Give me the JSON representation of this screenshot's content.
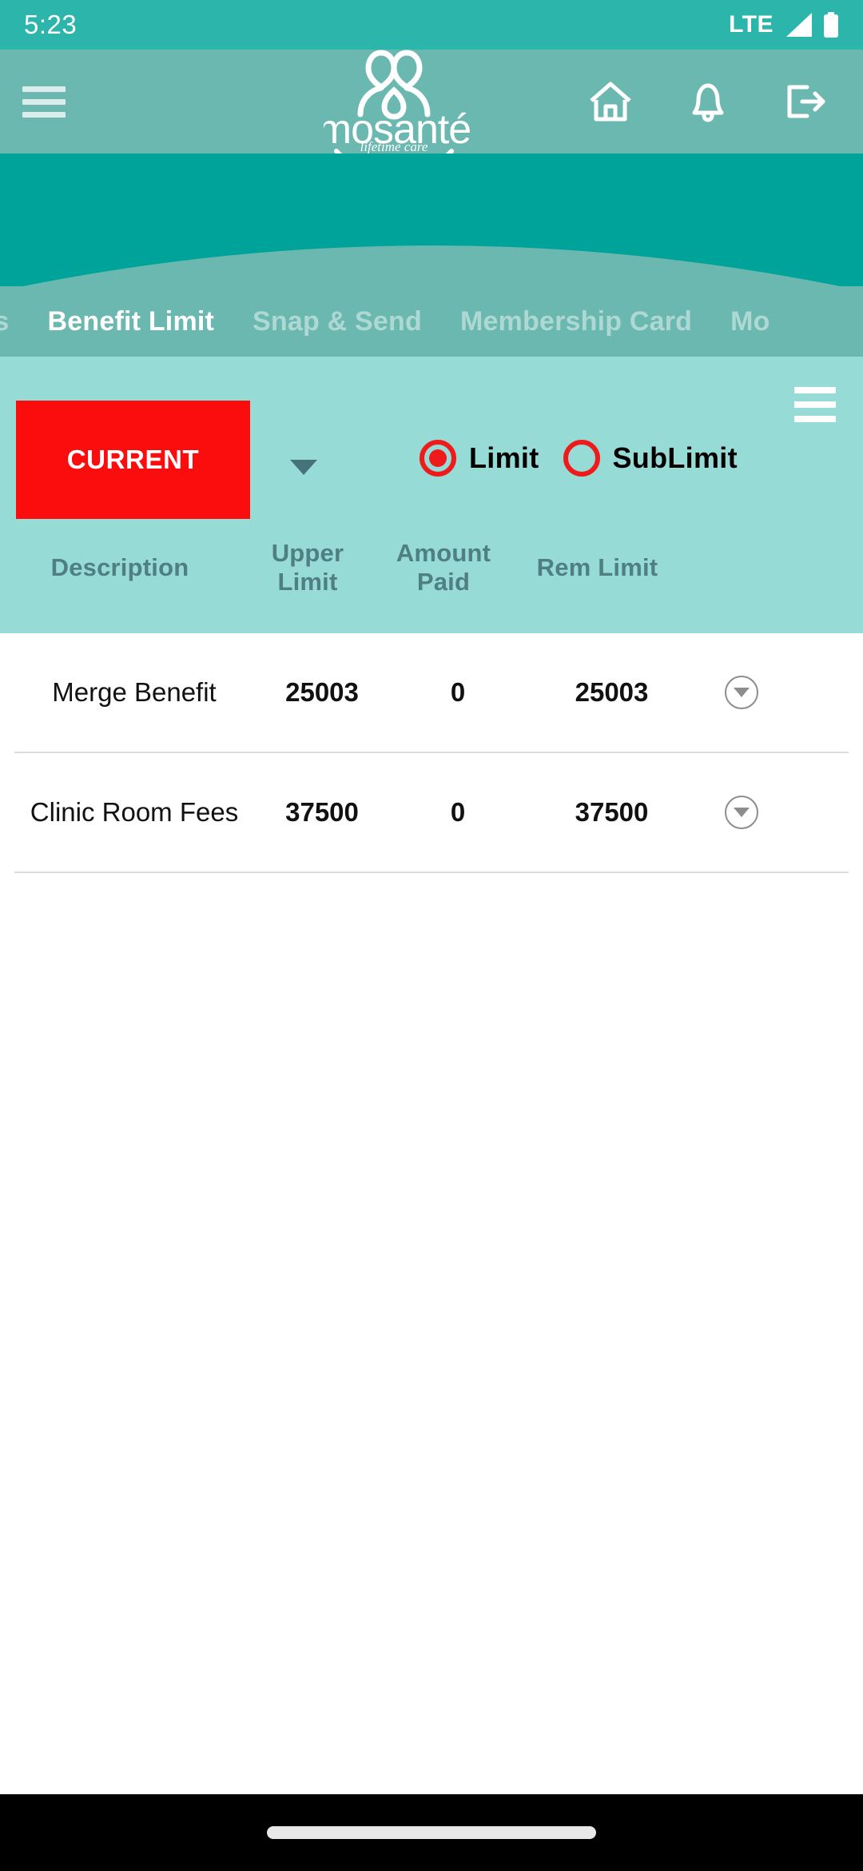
{
  "status_bar": {
    "time": "5:23",
    "network": "LTE",
    "signal_icon": "signal-triangle-icon",
    "battery_icon": "battery-full-icon"
  },
  "header": {
    "menu_icon": "hamburger-menu-icon",
    "brand_name": "mosanté",
    "brand_tagline": "lifetime care",
    "logo_icon": "two-people-logo-icon",
    "icons": [
      {
        "name": "home-icon",
        "label": "Home"
      },
      {
        "name": "bell-icon",
        "label": "Notifications"
      },
      {
        "name": "logout-icon",
        "label": "Logout"
      }
    ]
  },
  "tabs": [
    {
      "label": "ms",
      "active": false,
      "clipped": true
    },
    {
      "label": "Benefit Limit",
      "active": true,
      "clipped": false
    },
    {
      "label": "Snap & Send",
      "active": false,
      "clipped": false
    },
    {
      "label": "Membership Card",
      "active": false,
      "clipped": false
    },
    {
      "label": "Mo",
      "active": false,
      "clipped": true
    }
  ],
  "panel": {
    "menu_icon": "panel-hamburger-icon",
    "period_button": "CURRENT",
    "dropdown_icon": "chevron-down-icon",
    "radios": [
      {
        "label": "Limit",
        "selected": true
      },
      {
        "label": "SubLimit",
        "selected": false
      }
    ]
  },
  "table": {
    "columns": [
      "Description",
      "Upper Limit",
      "Amount Paid",
      "Rem Limit"
    ],
    "rows": [
      {
        "description": "Merge Benefit",
        "upper_limit": "25003",
        "amount_paid": "0",
        "rem_limit": "25003",
        "expand_icon": "row-expand-icon"
      },
      {
        "description": "Clinic Room Fees",
        "upper_limit": "37500",
        "amount_paid": "0",
        "rem_limit": "37500",
        "expand_icon": "row-expand-icon"
      }
    ]
  },
  "nav_bar": {
    "home_pill": "home-gesture-pill"
  },
  "colors": {
    "status_bar": "#2cb5ab",
    "header": "#6bb8b0",
    "curve_band": "#00a39a",
    "panel": "#96dbd6",
    "accent_red": "#fc0d0d",
    "radio_red": "#ef1b1b",
    "header_text": "#4f7e83"
  }
}
